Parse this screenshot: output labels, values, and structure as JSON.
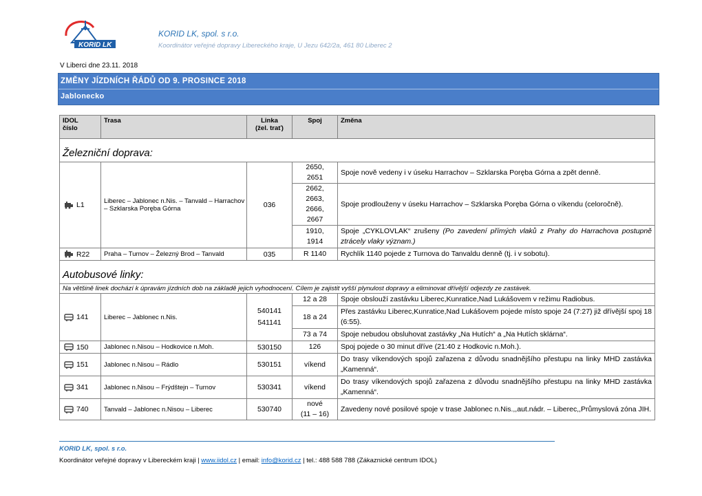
{
  "header": {
    "logo_text": "KORID LK",
    "company": "KORID LK, spol. s r.o.",
    "company_sub": "Koordinátor veřejné dopravy Libereckého kraje, U Jezu 642/2a, 461 80 Liberec 2",
    "date": "V Liberci dne 23.11. 2018"
  },
  "banner": {
    "title": "ZMĚNY JÍZDNÍCH ŘÁDŮ OD 9. PROSINCE 2018",
    "subtitle": "Jablonecko"
  },
  "table": {
    "headers": {
      "idol": "IDOL",
      "idol2": "číslo",
      "trasa": "Trasa",
      "linka": "Linka",
      "linka2": "(žel. trať)",
      "spoj": "Spoj",
      "zmena": "Změna"
    },
    "section_rail": "Železniční doprava:",
    "section_bus": "Autobusové linky:",
    "bus_note": "Na většině linek dochází k úpravám jízdních dob na základě jejich vyhodnocení. Cílem je zajistit vyšší plynulost dopravy a eliminovat dřívější odjezdy ze zastávek.",
    "rail": {
      "l1": {
        "idol": "L1",
        "trasa": "Liberec – Jablonec n.Nis. – Tanvald – Harrachov – Szklarska Poręba Górna",
        "linka": "036",
        "rows": [
          {
            "spoj": "2650,\n2651",
            "zmena": "Spoje nově vedeny i v úseku Harrachov – Szklarska Poręba Górna a zpět denně."
          },
          {
            "spoj": "2662,\n2663,\n2666,\n2667",
            "zmena": "Spoje prodlouženy v úseku Harrachov – Szklarska Poręba Górna o víkendu (celoročně)."
          },
          {
            "spoj": "1910,\n1914",
            "zmena_a": "Spoje „CYKLOVLAK“ zrušeny ",
            "zmena_b": "(Po zavedení přímých vlaků z Prahy do Harrachova postupně ztrácely vlaky význam.)"
          }
        ]
      },
      "r22": {
        "idol": "R22",
        "trasa": "Praha – Turnov – Železný Brod – Tanvald",
        "linka": "035",
        "spoj": "R 1140",
        "zmena": "Rychlík 1140 pojede z Turnova do Tanvaldu denně (tj. i v sobotu)."
      }
    },
    "bus": {
      "b141": {
        "idol": "141",
        "trasa": "Liberec – Jablonec n.Nis.",
        "linka": "540141\n541141",
        "rows": [
          {
            "spoj": "12 a 28",
            "zmena": "Spoje obslouží zastávku Liberec,Kunratice,Nad Lukášovem v režimu Radiobus."
          },
          {
            "spoj": "18 a 24",
            "zmena": "Přes zastávku Liberec,Kunratice,Nad Lukášovem pojede místo spoje 24 (7:27) již dřívější spoj 18 (6:55)."
          },
          {
            "spoj": "73 a 74",
            "zmena": "Spoje nebudou obsluhovat zastávky „Na Hutích“ a „Na Hutích sklárna“."
          }
        ]
      },
      "b150": {
        "idol": "150",
        "trasa": "Jablonec n.Nisou – Hodkovice n.Moh.",
        "linka": "530150",
        "spoj": "126",
        "zmena": "Spoj pojede o 30 minut dříve (21:40 z Hodkovic n.Moh.)."
      },
      "b151": {
        "idol": "151",
        "trasa": "Jablonec n.Nisou – Rádlo",
        "linka": "530151",
        "spoj": "víkend",
        "zmena": "Do trasy víkendových spojů zařazena z důvodu snadnějšího přestupu na linky MHD zastávka „Kamenná“."
      },
      "b341": {
        "idol": "341",
        "trasa": "Jablonec n.Nisou – Frýdštejn – Turnov",
        "linka": "530341",
        "spoj": "víkend",
        "zmena": "Do trasy víkendových spojů zařazena z důvodu snadnějšího přestupu na linky MHD zastávka „Kamenná“."
      },
      "b740": {
        "idol": "740",
        "trasa": "Tanvald – Jablonec n.Nisou – Liberec",
        "linka": "530740",
        "spoj": "nové\n(11 – 16)",
        "zmena": "Zavedeny nové posilové spoje v trase Jablonec n.Nis.,,aut.nádr. – Liberec,,Průmyslová zóna JIH."
      }
    }
  },
  "footer": {
    "company": "KORID LK, spol. s r.o.",
    "text_a": "Koordinátor veřejné dopravy v Libereckém kraji | ",
    "web": "www.iidol.cz",
    "text_b": " | email: ",
    "email": "info@korid.cz",
    "text_c": " | tel.: 488 588 788 (Zákaznické centrum IDOL)"
  },
  "colors": {
    "banner": "#4a7ec9",
    "accent": "#2e75b6",
    "header_bg": "#d9d9d9"
  },
  "icons": {
    "train": "train-icon",
    "bus": "bus-icon"
  }
}
